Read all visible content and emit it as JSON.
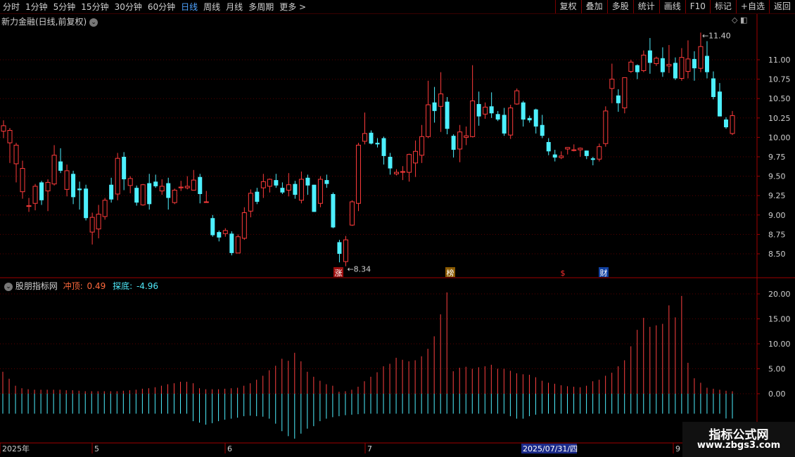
{
  "toolbar": {
    "periods": [
      "分时",
      "1分钟",
      "5分钟",
      "15分钟",
      "30分钟",
      "60分钟",
      "日线",
      "周线",
      "月线",
      "多周期",
      "更多 >"
    ],
    "active_period": "日线",
    "actions": [
      "复权",
      "叠加",
      "多股",
      "统计",
      "画线",
      "F10",
      "标记",
      "+自选",
      "返回"
    ]
  },
  "stock": {
    "title": "新力金融(日线,前复权)",
    "title_btn": "⌄",
    "corner_icons": "◇ ◧"
  },
  "price_axis": {
    "ticks": [
      "11.00",
      "10.75",
      "10.50",
      "10.25",
      "10.00",
      "9.75",
      "9.50",
      "9.25",
      "9.00",
      "8.75",
      "8.50"
    ]
  },
  "annotations": {
    "high": "11.40",
    "low": "8.34",
    "markers": [
      {
        "text": "涨",
        "color": "#ffffff",
        "bg": "#a01010"
      },
      {
        "text": "榜",
        "color": "#ffffff",
        "bg": "#8a5a00"
      },
      {
        "text": "$",
        "color": "#ff3030",
        "bg": ""
      },
      {
        "text": "财",
        "color": "#ffffff",
        "bg": "#1040a0"
      }
    ]
  },
  "indicator": {
    "name": "股朋指标网",
    "chong_label": "冲顶:",
    "chong_value": "0.49",
    "tan_label": "探底:",
    "tan_value": "-4.96",
    "ticks": [
      "20.00",
      "15.00",
      "10.00",
      "5.00",
      "0.00"
    ]
  },
  "date_axis": {
    "labels": [
      "2025年",
      "5",
      "6",
      "7",
      "9"
    ],
    "highlight": "2025/07/31/四"
  },
  "watermark": {
    "title": "指标公式网",
    "url": "www.zbgs3.com"
  },
  "colors": {
    "up": "#ff3b3b",
    "down": "#4df0ff",
    "grid": "#5a0000",
    "axis_line": "#a00000",
    "active_tab": "#4fa3ff"
  },
  "chart_data": [
    {
      "type": "candlestick",
      "title": "新力金融(日线,前复权)",
      "ylim": [
        8.34,
        11.4
      ],
      "candles": [
        [
          10.08,
          10.15,
          9.99,
          10.22
        ],
        [
          9.93,
          10.09,
          9.67,
          10.12
        ],
        [
          9.66,
          9.9,
          9.42,
          9.93
        ],
        [
          9.3,
          9.6,
          9.21,
          9.7
        ],
        [
          9.11,
          9.12,
          9.04,
          9.22
        ],
        [
          9.15,
          9.37,
          9.06,
          9.4
        ],
        [
          9.42,
          9.19,
          9.13,
          9.44
        ],
        [
          9.31,
          9.42,
          9.05,
          9.46
        ],
        [
          9.4,
          9.77,
          9.38,
          9.9
        ],
        [
          9.69,
          9.57,
          9.54,
          9.86
        ],
        [
          9.33,
          9.57,
          9.24,
          9.65
        ],
        [
          9.53,
          9.23,
          9.14,
          9.57
        ],
        [
          9.34,
          9.32,
          9.07,
          9.43
        ],
        [
          9.34,
          8.96,
          8.93,
          9.39
        ],
        [
          8.78,
          8.97,
          8.62,
          9.03
        ],
        [
          8.82,
          9.01,
          8.7,
          9.13
        ],
        [
          8.98,
          9.19,
          8.94,
          9.22
        ],
        [
          9.39,
          9.2,
          9.16,
          9.48
        ],
        [
          9.27,
          9.73,
          9.19,
          9.8
        ],
        [
          9.75,
          9.46,
          9.32,
          9.81
        ],
        [
          9.38,
          9.47,
          9.28,
          9.5
        ],
        [
          9.35,
          9.16,
          9.12,
          9.38
        ],
        [
          9.13,
          9.39,
          9.12,
          9.4
        ],
        [
          9.41,
          9.14,
          9.07,
          9.53
        ],
        [
          9.43,
          9.37,
          9.35,
          9.52
        ],
        [
          9.31,
          9.37,
          9.26,
          9.46
        ],
        [
          9.41,
          9.22,
          9.07,
          9.48
        ],
        [
          9.16,
          9.32,
          9.14,
          9.34
        ],
        [
          9.35,
          9.36,
          9.31,
          9.44
        ],
        [
          9.35,
          9.37,
          9.33,
          9.5
        ],
        [
          9.32,
          9.45,
          9.32,
          9.58
        ],
        [
          9.49,
          9.27,
          9.15,
          9.53
        ],
        [
          9.17,
          9.17,
          9.16,
          9.31
        ],
        [
          8.96,
          8.74,
          8.72,
          9.0
        ],
        [
          8.78,
          8.71,
          8.66,
          8.8
        ],
        [
          8.76,
          8.8,
          8.72,
          8.83
        ],
        [
          8.76,
          8.51,
          8.48,
          8.79
        ],
        [
          8.51,
          8.72,
          8.51,
          8.75
        ],
        [
          8.7,
          9.03,
          8.68,
          9.1
        ],
        [
          9.05,
          9.28,
          8.97,
          9.33
        ],
        [
          9.3,
          9.17,
          9.14,
          9.35
        ],
        [
          9.35,
          9.43,
          9.22,
          9.53
        ],
        [
          9.37,
          9.46,
          9.29,
          9.47
        ],
        [
          9.45,
          9.38,
          9.35,
          9.53
        ],
        [
          9.35,
          9.29,
          9.27,
          9.42
        ],
        [
          9.32,
          9.39,
          9.24,
          9.54
        ],
        [
          9.4,
          9.26,
          9.21,
          9.44
        ],
        [
          9.19,
          9.46,
          9.15,
          9.56
        ],
        [
          9.48,
          9.38,
          9.26,
          9.52
        ],
        [
          9.39,
          9.04,
          9.04,
          9.39
        ],
        [
          9.15,
          9.46,
          9.1,
          9.5
        ],
        [
          9.45,
          9.4,
          9.35,
          9.52
        ],
        [
          9.27,
          8.84,
          8.83,
          9.29
        ],
        [
          8.65,
          8.5,
          8.39,
          8.68
        ],
        [
          8.4,
          8.68,
          8.34,
          8.73
        ],
        [
          8.87,
          9.17,
          8.86,
          9.19
        ],
        [
          9.15,
          9.9,
          9.05,
          9.93
        ],
        [
          9.95,
          10.05,
          9.91,
          10.32
        ],
        [
          10.06,
          9.92,
          9.91,
          10.09
        ],
        [
          9.93,
          9.91,
          9.87,
          9.99
        ],
        [
          9.99,
          9.76,
          9.65,
          10.01
        ],
        [
          9.75,
          9.6,
          9.52,
          9.8
        ],
        [
          9.53,
          9.55,
          9.51,
          9.59
        ],
        [
          9.55,
          9.56,
          9.45,
          9.63
        ],
        [
          9.55,
          9.78,
          9.43,
          9.79
        ],
        [
          9.67,
          9.82,
          9.49,
          9.96
        ],
        [
          9.77,
          10.01,
          9.67,
          10.16
        ],
        [
          10.01,
          10.42,
          9.99,
          10.73
        ],
        [
          10.45,
          10.34,
          10.19,
          10.65
        ],
        [
          10.4,
          10.56,
          10.07,
          10.84
        ],
        [
          10.46,
          10.11,
          10.04,
          10.52
        ],
        [
          10.02,
          9.84,
          9.74,
          10.04
        ],
        [
          9.85,
          10.07,
          9.68,
          10.16
        ],
        [
          10.0,
          10.02,
          9.9,
          10.14
        ],
        [
          10.01,
          10.47,
          10.0,
          10.93
        ],
        [
          10.43,
          10.27,
          10.15,
          10.59
        ],
        [
          10.3,
          10.39,
          10.24,
          10.45
        ],
        [
          10.4,
          10.31,
          10.25,
          10.58
        ],
        [
          10.3,
          10.23,
          10.21,
          10.34
        ],
        [
          10.29,
          10.05,
          10.02,
          10.38
        ],
        [
          10.03,
          10.38,
          9.98,
          10.42
        ],
        [
          10.43,
          10.6,
          10.42,
          10.63
        ],
        [
          10.45,
          10.23,
          10.14,
          10.47
        ],
        [
          10.25,
          10.22,
          10.19,
          10.28
        ],
        [
          10.36,
          10.14,
          10.05,
          10.37
        ],
        [
          10.16,
          10.02,
          9.99,
          10.29
        ],
        [
          9.94,
          9.82,
          9.77,
          9.99
        ],
        [
          9.78,
          9.74,
          9.69,
          9.84
        ],
        [
          9.74,
          9.76,
          9.72,
          9.82
        ],
        [
          9.85,
          9.87,
          9.78,
          9.86
        ],
        [
          9.83,
          9.84,
          9.82,
          9.91
        ],
        [
          9.84,
          9.86,
          9.75,
          9.87
        ],
        [
          9.83,
          9.76,
          9.72,
          9.83
        ],
        [
          9.73,
          9.71,
          9.64,
          9.75
        ],
        [
          9.72,
          9.88,
          9.69,
          9.92
        ],
        [
          9.92,
          10.34,
          9.88,
          10.4
        ],
        [
          10.63,
          10.75,
          10.44,
          10.95
        ],
        [
          10.54,
          10.44,
          10.33,
          10.62
        ],
        [
          10.38,
          10.77,
          10.31,
          10.77
        ],
        [
          10.85,
          10.97,
          10.83,
          11.0
        ],
        [
          10.93,
          10.84,
          10.75,
          10.94
        ],
        [
          10.86,
          11.06,
          10.84,
          11.12
        ],
        [
          11.12,
          10.96,
          10.82,
          11.28
        ],
        [
          10.95,
          11.02,
          10.92,
          11.04
        ],
        [
          11.02,
          10.84,
          10.78,
          11.16
        ],
        [
          10.92,
          10.94,
          10.83,
          11.19
        ],
        [
          10.96,
          10.76,
          10.74,
          11.03
        ],
        [
          10.76,
          11.03,
          10.73,
          11.15
        ],
        [
          10.85,
          11.01,
          10.76,
          11.25
        ],
        [
          11.01,
          10.89,
          10.73,
          11.11
        ],
        [
          10.89,
          11.17,
          10.84,
          11.35
        ],
        [
          11.05,
          10.84,
          10.76,
          11.24
        ],
        [
          10.76,
          10.52,
          10.49,
          10.85
        ],
        [
          10.59,
          10.27,
          10.27,
          10.7
        ],
        [
          10.23,
          10.13,
          10.11,
          10.26
        ],
        [
          10.05,
          10.28,
          10.03,
          10.34
        ]
      ],
      "candle_fields": [
        "open",
        "close",
        "low",
        "high"
      ]
    },
    {
      "type": "bar",
      "title": "股朋指标网",
      "ylim": [
        -6,
        21
      ],
      "series": [
        {
          "name": "冲顶",
          "color": "#ff4040",
          "values": [
            4.4,
            3.0,
            1.6,
            1.1,
            0.9,
            0.8,
            0.8,
            0.8,
            0.8,
            0.8,
            0.7,
            0.7,
            0.6,
            0.5,
            0.5,
            0.5,
            0.5,
            0.5,
            0.5,
            0.6,
            0.7,
            0.8,
            1.0,
            1.1,
            1.3,
            1.6,
            1.9,
            2.1,
            2.4,
            2.4,
            2.1,
            1.1,
            0.9,
            0.9,
            0.9,
            1.0,
            1.1,
            1.2,
            1.6,
            2.1,
            2.8,
            3.6,
            4.7,
            5.6,
            7.0,
            6.6,
            8.2,
            6.5,
            4.4,
            3.4,
            2.6,
            1.9,
            1.6,
            0.4,
            0.5,
            0.8,
            1.4,
            2.5,
            3.4,
            4.3,
            5.5,
            6.0,
            7.2,
            6.8,
            6.5,
            6.7,
            7.5,
            9.0,
            11.5,
            15.9,
            20.3,
            4.5,
            5.2,
            5.4,
            5.0,
            5.3,
            5.5,
            5.8,
            5.0,
            5.0,
            4.6,
            4.1,
            3.9,
            3.8,
            3.3,
            2.6,
            2.2,
            2.0,
            1.7,
            1.5,
            1.4,
            1.3,
            1.6,
            2.5,
            2.8,
            3.6,
            4.2,
            5.5,
            6.7,
            9.5,
            12.8,
            15.2,
            13.4,
            13.7,
            14.0,
            17.7,
            15.3,
            19.6,
            6.2,
            3.1,
            2.2,
            1.2,
            1.0,
            0.8,
            0.6,
            0.49
          ]
        },
        {
          "name": "探底",
          "color": "#4df0ff",
          "values": [
            -4.0,
            -4.0,
            -4.0,
            -4.0,
            -4.0,
            -4.0,
            -4.0,
            -4.0,
            -4.0,
            -4.0,
            -4.0,
            -4.0,
            -4.0,
            -4.0,
            -4.0,
            -4.0,
            -4.0,
            -4.0,
            -4.0,
            -4.0,
            -4.0,
            -4.0,
            -4.0,
            -4.0,
            -4.0,
            -4.0,
            -4.0,
            -4.0,
            -4.0,
            -4.0,
            -5.5,
            -5.8,
            -6.2,
            -5.9,
            -5.5,
            -5.2,
            -5.0,
            -4.8,
            -4.5,
            -4.4,
            -4.5,
            -4.6,
            -5.0,
            -6.0,
            -7.5,
            -8.5,
            -9.0,
            -8.0,
            -7.0,
            -6.5,
            -5.5,
            -5.0,
            -4.7,
            -4.5,
            -4.3,
            -4.2,
            -4.1,
            -4.0,
            -4.0,
            -4.0,
            -4.0,
            -4.0,
            -4.0,
            -4.0,
            -4.0,
            -4.0,
            -4.0,
            -4.0,
            -4.0,
            -4.0,
            -4.0,
            -4.0,
            -4.0,
            -4.0,
            -4.0,
            -4.0,
            -4.0,
            -4.0,
            -4.0,
            -4.0,
            -4.5,
            -5.0,
            -5.0,
            -4.5,
            -4.2,
            -4.0,
            -4.0,
            -4.0,
            -4.0,
            -4.0,
            -4.0,
            -4.0,
            -4.0,
            -4.0,
            -4.0,
            -4.0,
            -4.0,
            -4.0,
            -4.0,
            -4.0,
            -4.0,
            -4.0,
            -4.0,
            -4.0,
            -4.0,
            -4.0,
            -4.0,
            -4.0,
            -4.0,
            -4.0,
            -4.0,
            -4.0,
            -4.0,
            -4.0,
            -4.96,
            -4.96
          ]
        }
      ]
    }
  ]
}
